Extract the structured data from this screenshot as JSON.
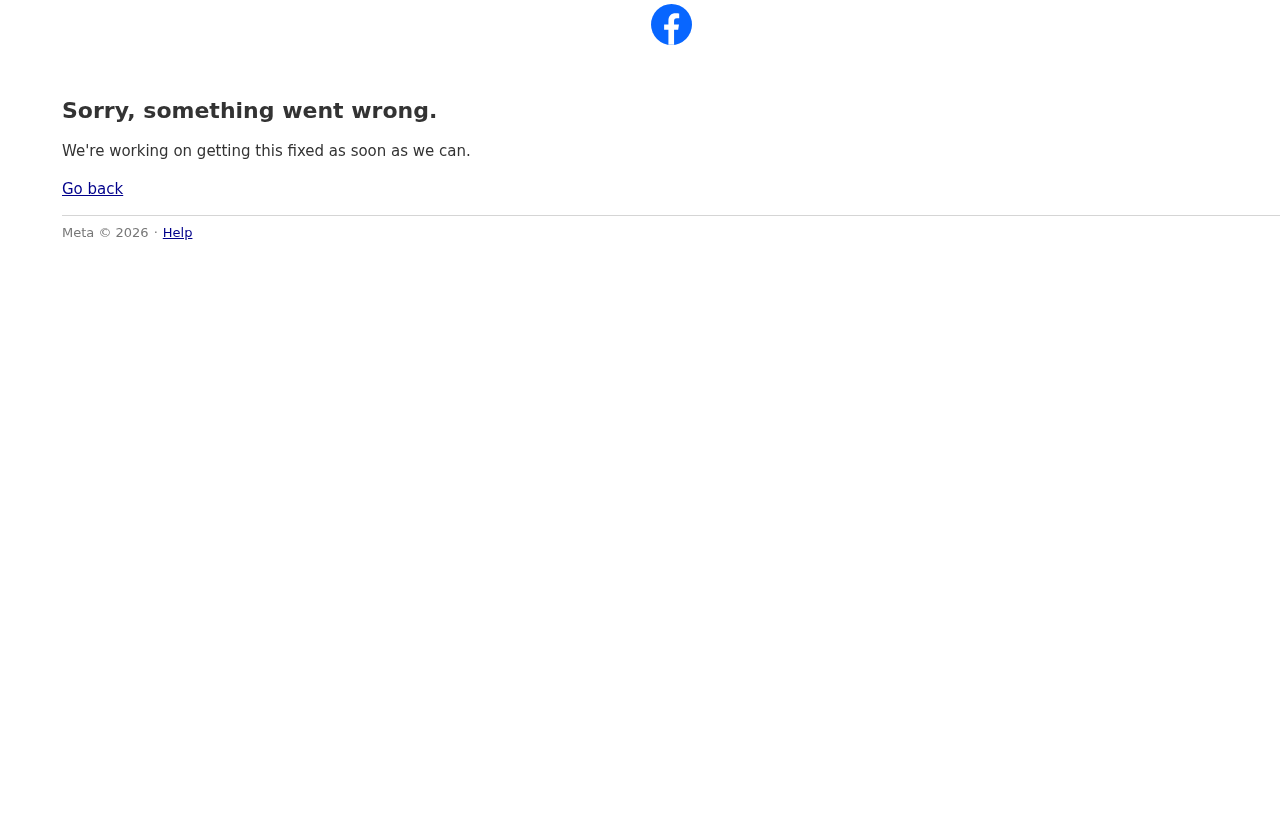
{
  "heading": "Sorry, something went wrong.",
  "message": "We're working on getting this fixed as soon as we can.",
  "back_link": "Go back",
  "footer": {
    "copyright": "Meta © 2026",
    "separator": "·",
    "help_link": "Help"
  }
}
